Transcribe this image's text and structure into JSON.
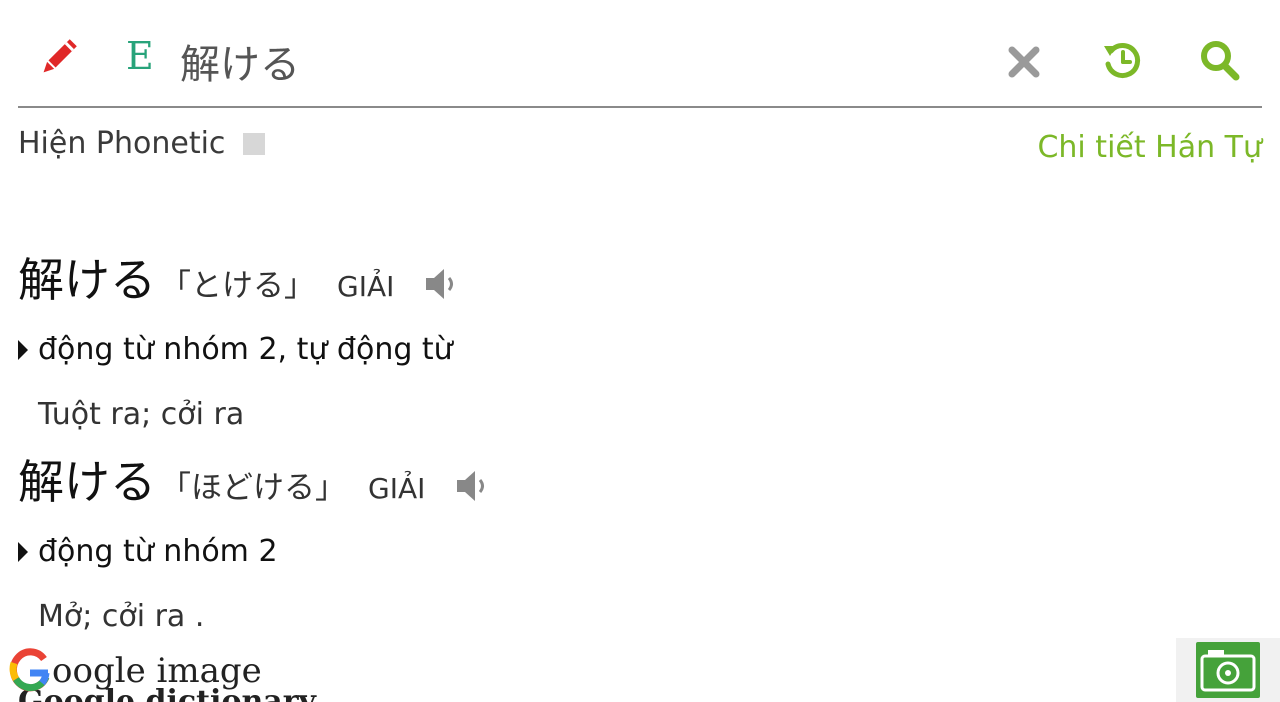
{
  "search": {
    "lang_label": "E",
    "query": "解ける"
  },
  "options": {
    "phonetic_label": "Hiện Phonetic",
    "kanji_detail_label": "Chi tiết Hán Tự"
  },
  "entries": [
    {
      "word": "解ける",
      "reading": "「とける」",
      "hanviet": "GIẢI",
      "pos": "động từ nhóm 2, tự động từ",
      "meaning": "Tuột ra; cởi ra"
    },
    {
      "word": "解ける",
      "reading": "「ほどける」",
      "hanviet": "GIẢI",
      "pos": "động từ nhóm 2",
      "meaning": "Mở; cởi ra ."
    }
  ],
  "footer": {
    "google_image_rest": "oogle image",
    "google_dictionary": "Google dictionary"
  },
  "colors": {
    "pencil": "#e02828",
    "accent_green": "#7cb828",
    "icon_gray": "#9a9a9a",
    "camera": "#45a23a"
  },
  "icons": [
    "pencil-icon",
    "close-icon",
    "history-icon",
    "search-icon",
    "speaker-icon",
    "google-g-icon",
    "camera-icon"
  ]
}
